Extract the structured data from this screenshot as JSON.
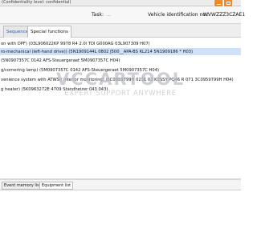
{
  "titlebar": {
    "confidentiality": "(Confidentiality level: confidential)",
    "colors": {
      "accent": "#f08a2a"
    }
  },
  "header": {
    "task_label": "Task:",
    "task_value": "...",
    "vin_label": "Vehicle identification no.:",
    "vin_value": "WVWZZZ3CZAE1"
  },
  "tabs": [
    {
      "label": "Sequence"
    },
    {
      "label": "Special functions"
    }
  ],
  "control_units": [
    {
      "text": "on with DPF) (03L906022KP    9978   R4 2.0l TDI G000AG    03L907309        H07)"
    },
    {
      "text": "ro-mechanical (left-hand drive)) (5N1909144L    0802   J500__APA-BS KL214  5N1909186 *   H03)"
    },
    {
      "text": "(5N0907357C    0142   AFS-Steuergeraet     5M0907357C     H04)"
    },
    {
      "text": "g/cornering lamp) (5M0907357C    0142   AFS-Steuergeraet     5M0907357C     H04)"
    },
    {
      "text": "venience system with ATWS / interior monitoring) (3C0959799H    0231  02 KESSY PQ46 R 071   3C0959799H    H04)"
    },
    {
      "text": "g heater) (5K0963272E    4709   Standheizer      043        043)"
    }
  ],
  "watermark": {
    "logo": "VCCARTOOL",
    "slogan": "EXPERT SUPPORT ANYWHERE"
  },
  "bottom_tabs": [
    {
      "label": "Event memory list"
    },
    {
      "label": "Equipment list"
    }
  ],
  "icons": {
    "minimize": "minimize-icon",
    "maximize": "maximize-icon"
  }
}
